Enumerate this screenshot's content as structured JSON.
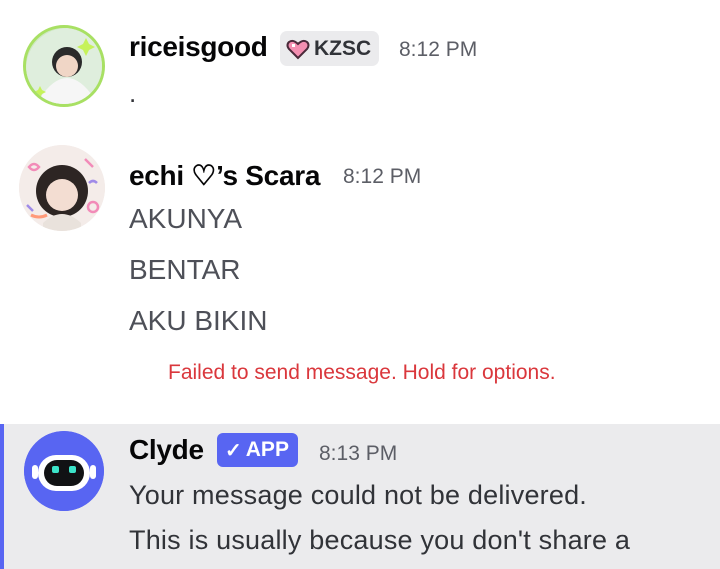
{
  "messages": [
    {
      "author": "riceisgood",
      "tag": "KZSC",
      "timestamp": "8:12 PM",
      "lines": [
        "."
      ]
    },
    {
      "author": "echi ♡’s Scara",
      "timestamp": "8:12 PM",
      "lines": [
        "AKUNYA",
        "BENTAR",
        "AKU BIKIN"
      ],
      "error": "Failed to send message. Hold for options."
    },
    {
      "author": "Clyde",
      "badge": "APP",
      "timestamp": "8:13 PM",
      "lines": [
        "Your message could not be delivered.",
        "This is usually because you don't share a"
      ]
    }
  ],
  "colors": {
    "accent": "#5865f2",
    "error": "#da373c",
    "highlight_bg": "#ebebed"
  },
  "icons": {
    "tag": "pixel-heart-icon",
    "badge": "checkmark-icon"
  }
}
